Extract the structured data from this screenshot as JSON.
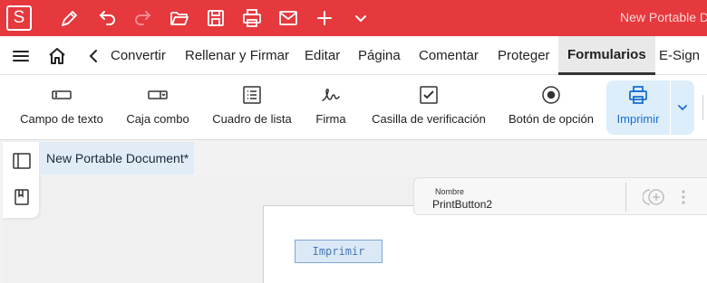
{
  "app": {
    "logo_letter": "S",
    "document_title": "New Portable D"
  },
  "titlebar": {
    "icons": [
      "pen-icon",
      "undo-icon",
      "redo-icon",
      "open-folder-icon",
      "save-icon",
      "print-icon",
      "mail-icon",
      "plus-icon",
      "chevron-down-icon"
    ]
  },
  "menubar": {
    "items": [
      {
        "label": "Convertir"
      },
      {
        "label": "Rellenar y Firmar"
      },
      {
        "label": "Editar"
      },
      {
        "label": "Página"
      },
      {
        "label": "Comentar"
      },
      {
        "label": "Proteger"
      },
      {
        "label": "Formularios",
        "active": true
      },
      {
        "label": "E-Sign"
      }
    ]
  },
  "ribbon": {
    "tools": [
      {
        "label": "Campo de texto",
        "icon": "text-field-icon"
      },
      {
        "label": "Caja combo",
        "icon": "combo-box-icon"
      },
      {
        "label": "Cuadro de lista",
        "icon": "list-box-icon"
      },
      {
        "label": "Firma",
        "icon": "signature-icon"
      },
      {
        "label": "Casilla de verificación",
        "icon": "checkbox-icon"
      },
      {
        "label": "Botón de opción",
        "icon": "radio-button-icon"
      },
      {
        "label": "Imprimir",
        "icon": "print-icon",
        "active": true
      }
    ]
  },
  "doc_tab": {
    "label": "New Portable Document*"
  },
  "properties": {
    "name_label": "Nombre",
    "name_value": "PrintButton2"
  },
  "canvas": {
    "button_caption": "Imprimir"
  },
  "colors": {
    "brand": "#e5393e",
    "accent": "#1a6fd0",
    "tab_bg": "#e1ecf7"
  }
}
